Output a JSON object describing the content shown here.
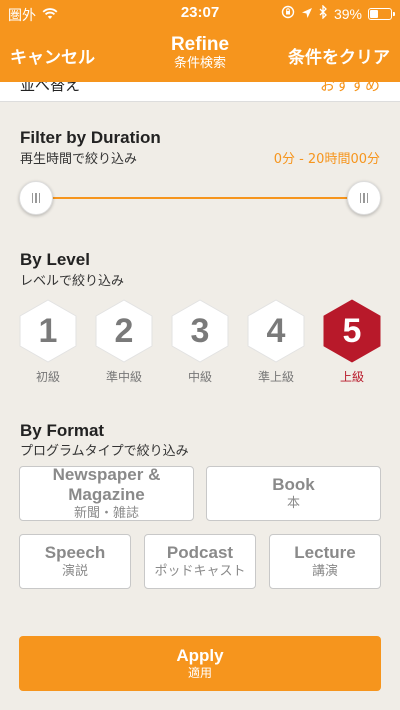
{
  "status_bar": {
    "carrier": "圏外",
    "time": "23:07",
    "battery_percent": "39%",
    "battery_level": 0.39,
    "icons": [
      "wifi-icon",
      "rotation-lock-icon",
      "location-arrow-icon",
      "bluetooth-icon",
      "battery-icon"
    ]
  },
  "nav": {
    "cancel_label": "キャンセル",
    "title": "Refine",
    "subtitle": "条件検索",
    "clear_label": "条件をクリア"
  },
  "sort": {
    "label": "並べ替え",
    "value": "おすすめ"
  },
  "duration": {
    "title": "Filter by Duration",
    "subtitle": "再生時間で絞り込み",
    "value": "0分 - 20時間00分",
    "min_fraction": 0,
    "max_fraction": 1
  },
  "level": {
    "title": "By Level",
    "subtitle": "レベルで絞り込み",
    "items": [
      {
        "number": "1",
        "label": "初級",
        "selected": false
      },
      {
        "number": "2",
        "label": "準中級",
        "selected": false
      },
      {
        "number": "3",
        "label": "中級",
        "selected": false
      },
      {
        "number": "4",
        "label": "準上級",
        "selected": false
      },
      {
        "number": "5",
        "label": "上級",
        "selected": true
      }
    ]
  },
  "format": {
    "title": "By Format",
    "subtitle": "プログラムタイプで絞り込み",
    "items": [
      {
        "en": "Newspaper & Magazine",
        "jp": "新聞・雑誌"
      },
      {
        "en": "Book",
        "jp": "本"
      },
      {
        "en": "Speech",
        "jp": "演説"
      },
      {
        "en": "Podcast",
        "jp": "ポッドキャスト"
      },
      {
        "en": "Lecture",
        "jp": "講演"
      }
    ]
  },
  "apply": {
    "label": "Apply",
    "sublabel": "適用"
  },
  "colors": {
    "accent": "#f6951d",
    "selected_level": "#b8192a",
    "background": "#f0ede7"
  }
}
